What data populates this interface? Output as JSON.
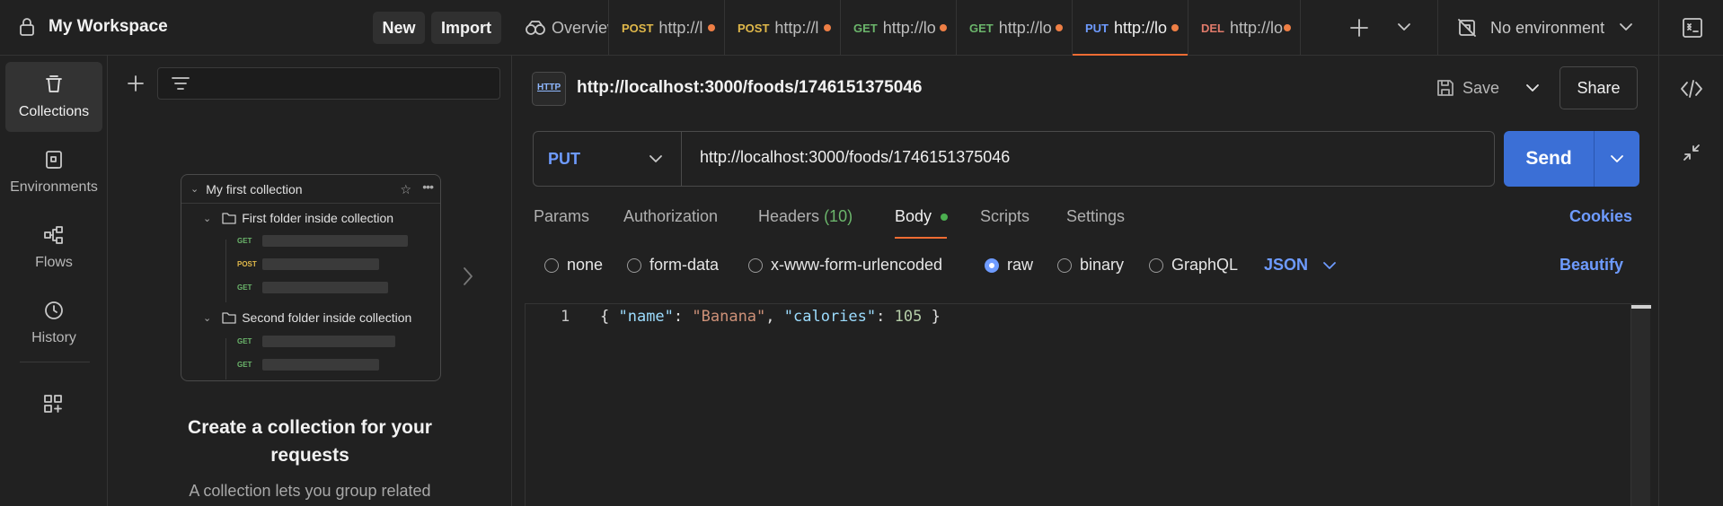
{
  "workspace": {
    "title": "My Workspace",
    "new_label": "New",
    "import_label": "Import"
  },
  "rail": {
    "items": [
      {
        "label": "Collections",
        "icon": "collections-icon",
        "active": true
      },
      {
        "label": "Environments",
        "icon": "environments-icon"
      },
      {
        "label": "Flows",
        "icon": "flows-icon"
      },
      {
        "label": "History",
        "icon": "history-icon"
      }
    ]
  },
  "collections_panel": {
    "preview": {
      "collection_name": "My first collection",
      "folder1": "First folder inside collection",
      "folder2": "Second folder inside collection",
      "methods": [
        "GET",
        "POST",
        "GET",
        "GET",
        "GET"
      ]
    },
    "empty_title": "Create a collection for your requests",
    "empty_desc": "A collection lets you group related"
  },
  "tabs": [
    {
      "method": "",
      "label": "Overview",
      "icon": "overview-icon"
    },
    {
      "method": "POST",
      "label": "http://l",
      "dirty": true
    },
    {
      "method": "POST",
      "label": "http://l",
      "dirty": true
    },
    {
      "method": "GET",
      "label": "http://lo",
      "dirty": true
    },
    {
      "method": "GET",
      "label": "http://lo",
      "dirty": true
    },
    {
      "method": "PUT",
      "label": "http://lo",
      "dirty": true,
      "active": true
    },
    {
      "method": "DEL",
      "label": "http://lo",
      "dirty": true
    }
  ],
  "environment": {
    "label": "No environment"
  },
  "request": {
    "title": "http://localhost:3000/foods/1746151375046",
    "save_label": "Save",
    "share_label": "Share",
    "method": "PUT",
    "url": "http://localhost:3000/foods/1746151375046",
    "send_label": "Send",
    "tabs": {
      "params": "Params",
      "authorization": "Authorization",
      "headers": "Headers",
      "headers_count": "(10)",
      "body": "Body",
      "scripts": "Scripts",
      "settings": "Settings"
    },
    "cookies_label": "Cookies",
    "body_types": {
      "none": "none",
      "form_data": "form-data",
      "urlencoded": "x-www-form-urlencoded",
      "raw": "raw",
      "binary": "binary",
      "graphql": "GraphQL"
    },
    "body_format": "JSON",
    "beautify_label": "Beautify",
    "editor": {
      "line_number": "1",
      "code": {
        "open": "{ ",
        "k1": "\"name\"",
        "sep1": ": ",
        "v1": "\"Banana\"",
        "comma": ", ",
        "k2": "\"calories\"",
        "sep2": ": ",
        "v2": "105",
        "close": " }"
      }
    }
  },
  "colors": {
    "accent_blue": "#3b6fd6",
    "link_blue": "#6e9bff",
    "tab_active": "#ef6c33",
    "unsaved_dot": "#ee7f45",
    "get": "#6bb56b",
    "post": "#e0b84a",
    "put": "#6e9bff",
    "delete": "#e07a6a"
  }
}
